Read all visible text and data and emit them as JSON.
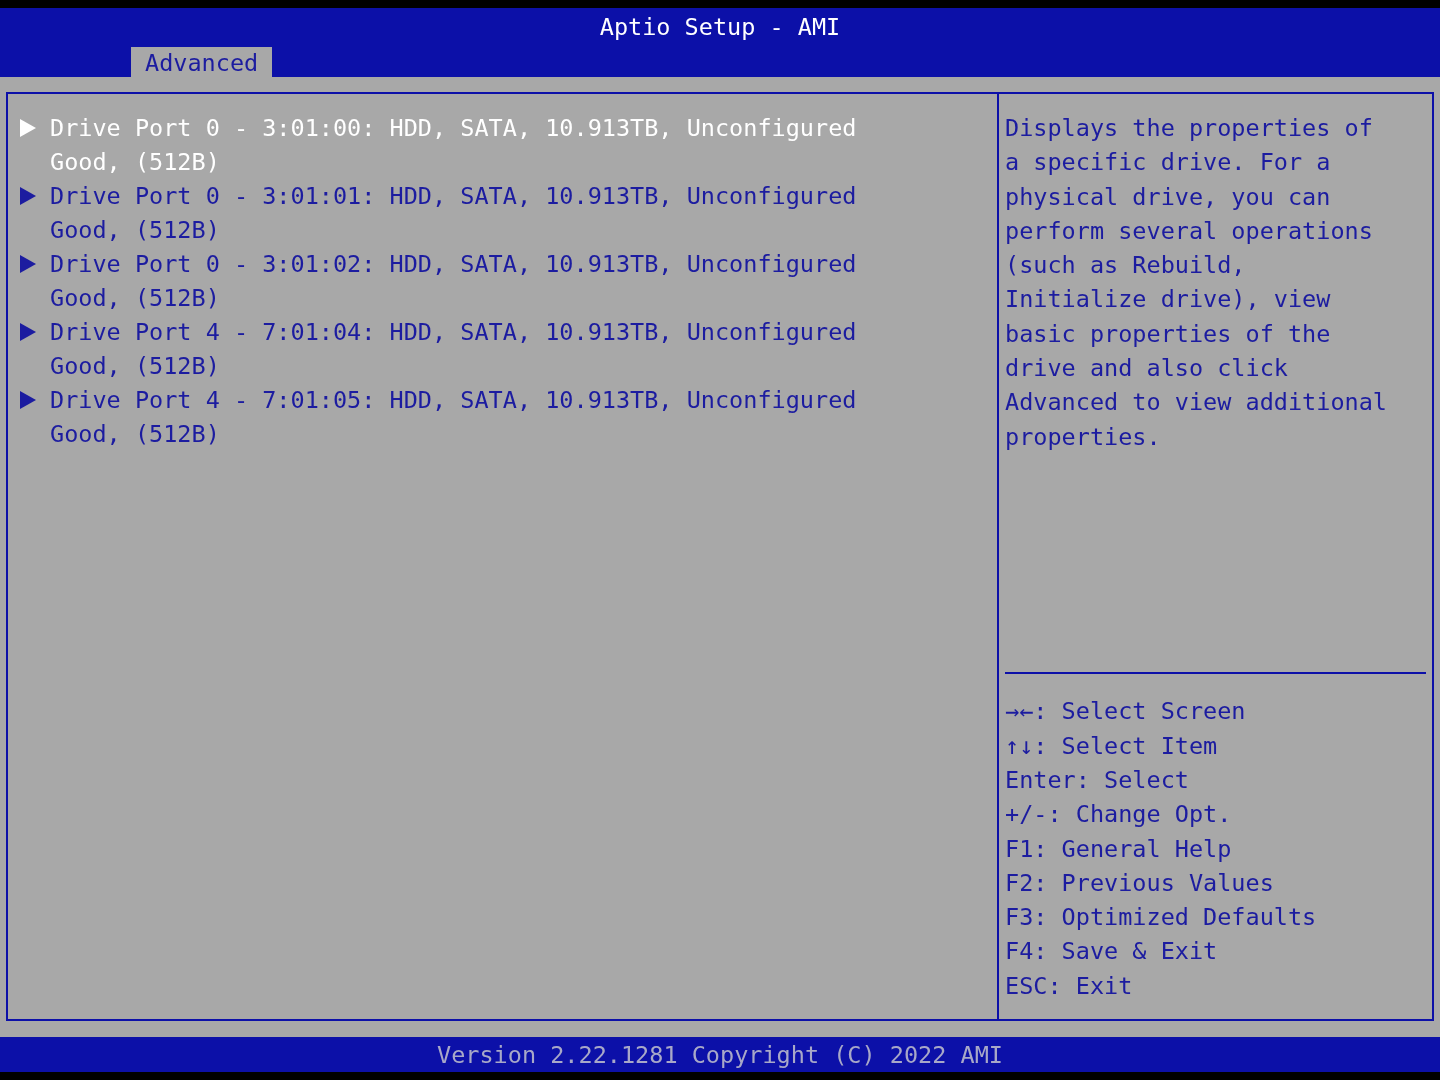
{
  "window": {
    "title": "Aptio Setup - AMI"
  },
  "tabs": [
    {
      "label": "Advanced",
      "selected": true
    }
  ],
  "items": [
    {
      "label": "Drive Port 0 - 3:01:00: HDD, SATA, 10.913TB, Unconfigured Good, (512B)",
      "selected": true
    },
    {
      "label": "Drive Port 0 - 3:01:01: HDD, SATA, 10.913TB, Unconfigured Good, (512B)",
      "selected": false
    },
    {
      "label": "Drive Port 0 - 3:01:02: HDD, SATA, 10.913TB, Unconfigured Good, (512B)",
      "selected": false
    },
    {
      "label": "Drive Port 4 - 7:01:04: HDD, SATA, 10.913TB, Unconfigured Good, (512B)",
      "selected": false
    },
    {
      "label": "Drive Port 4 - 7:01:05: HDD, SATA, 10.913TB, Unconfigured Good, (512B)",
      "selected": false
    }
  ],
  "help": {
    "description": "Displays the properties of a specific drive. For a physical drive, you can perform several operations (such as Rebuild, Initialize drive), view basic properties of the drive and also click Advanced to view additional properties.",
    "keys": [
      "→←: Select Screen",
      "↑↓: Select Item",
      "Enter: Select",
      "+/-: Change Opt.",
      "F1: General Help",
      "F2: Previous Values",
      "F3: Optimized Defaults",
      "F4: Save & Exit",
      "ESC: Exit"
    ]
  },
  "status_bar": "Version 2.22.1281 Copyright (C) 2022 AMI"
}
